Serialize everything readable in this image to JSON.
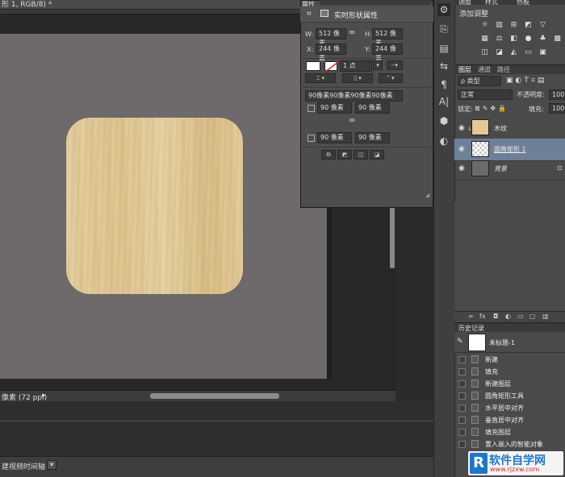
{
  "document": {
    "tab_title": "形 1, RGB/8) *",
    "zoom_status": "像素 (72 ppi)",
    "status_arrow": "▸",
    "timeline_label": "建视频时间轴",
    "timeline_dropdown": "▾"
  },
  "properties": {
    "panel_title": "属性",
    "header": "实时形状属性",
    "width_label": "W:",
    "width_value": "512 像素",
    "height_label": "H:",
    "height_value": "512 像素",
    "x_label": "X:",
    "x_value": "244 像素",
    "y_label": "Y:",
    "y_value": "244 像素",
    "stroke_width": "1 点",
    "corner_summary": "90像素90像素90像素90像素",
    "corner_tl": "90 像素",
    "corner_tr": "90 像素",
    "corner_bl": "90 像素",
    "corner_br": "90 像素",
    "link_icon": "∞"
  },
  "adjustments": {
    "tabs": [
      "调整",
      "样式",
      "色板"
    ],
    "title": "添加调整"
  },
  "layers": {
    "tabs": [
      "图层",
      "通道",
      "路径"
    ],
    "kind_filter": "ρ 类型",
    "blend_mode": "正常",
    "opacity_label": "不透明度:",
    "opacity_value": "100%",
    "lock_label": "锁定:",
    "fill_label": "填充:",
    "fill_value": "100%",
    "items": [
      {
        "name": "木纹",
        "visible": true,
        "selected": false
      },
      {
        "name": "圆角矩形 1",
        "visible": true,
        "selected": true
      },
      {
        "name": "背景",
        "visible": true,
        "selected": false,
        "locked": true
      }
    ],
    "footer_icons": [
      "link-icon",
      "fx-icon",
      "mask-icon",
      "adjustment-icon",
      "folder-icon",
      "new-layer-icon",
      "trash-icon"
    ]
  },
  "history": {
    "title": "历史记录",
    "snapshot": "未标题-1",
    "items": [
      "新建",
      "填充",
      "新建图层",
      "圆角矩形工具",
      "水平居中对齐",
      "垂直居中对齐",
      "填充图层",
      "置入嵌入的智能对象"
    ]
  },
  "watermark": {
    "logo": "R",
    "name": "软件自学网",
    "url": "www.rjzxw.com"
  },
  "colors": {
    "selected_layer": "#6e7f97",
    "artboard": "#6e6a6b",
    "wood": "#e2c995"
  }
}
